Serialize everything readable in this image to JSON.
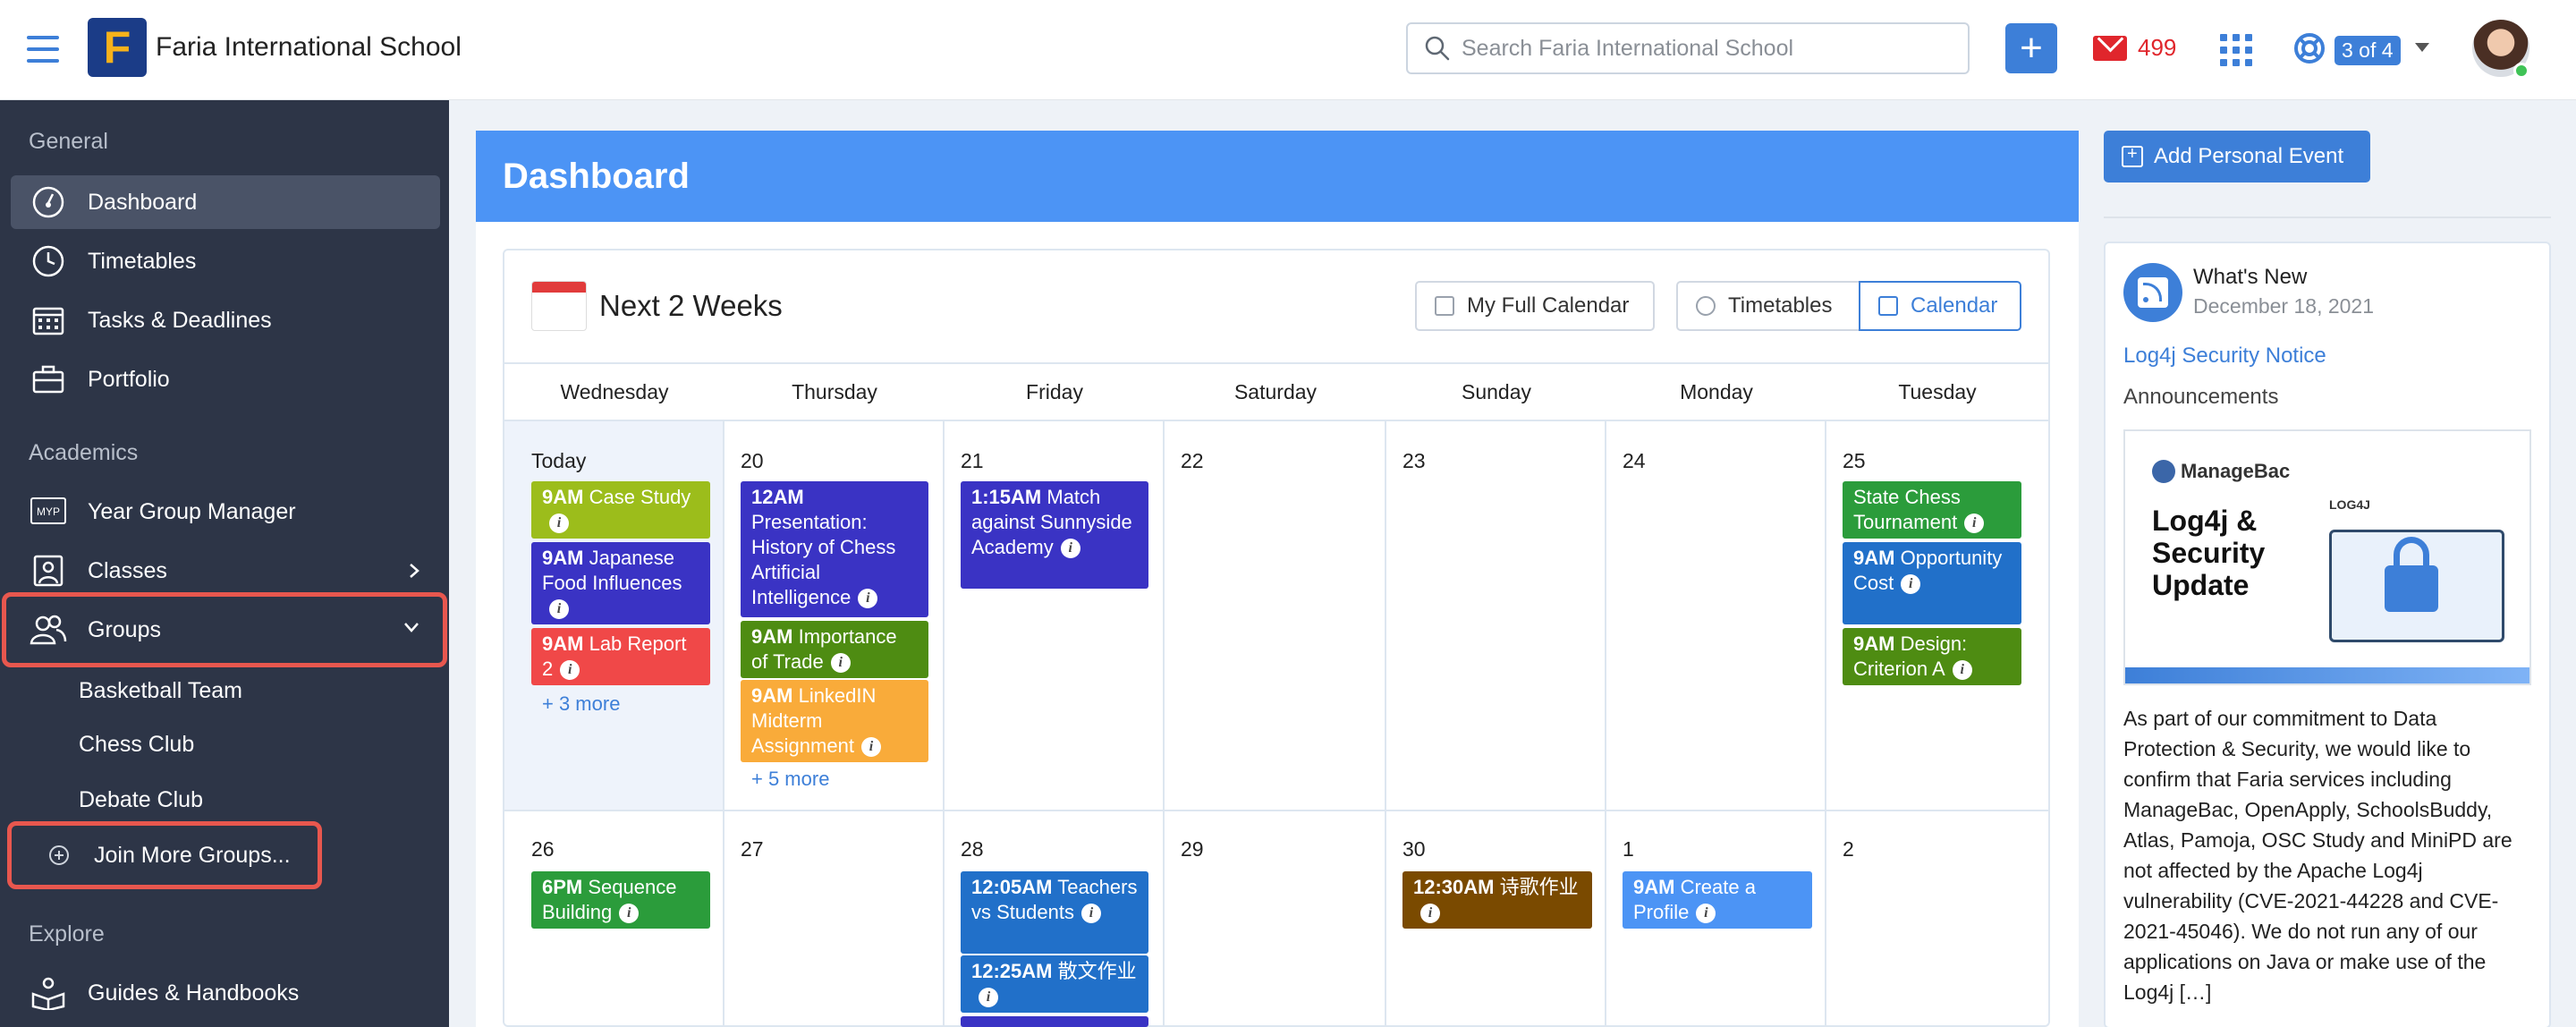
{
  "header": {
    "school_name": "Faria International School",
    "logo_letter": "F",
    "search_placeholder": "Search Faria International School",
    "add_label": "+",
    "mail_count": "499",
    "pager": "3 of 4",
    "colors": {
      "accent": "#3d7fd8",
      "mail": "#e0262c",
      "logo_bg": "#1b3c87",
      "logo_fg": "#f7b21b"
    }
  },
  "sidebar": {
    "sections": {
      "general": "General",
      "academics": "Academics",
      "explore": "Explore"
    },
    "items": {
      "dashboard": "Dashboard",
      "timetables": "Timetables",
      "tasks": "Tasks & Deadlines",
      "portfolio": "Portfolio",
      "year_group": "Year Group Manager",
      "classes": "Classes",
      "groups": "Groups",
      "guides": "Guides & Handbooks"
    },
    "groups": [
      "Basketball Team",
      "Chess Club",
      "Debate Club"
    ],
    "join_more": "Join More Groups...",
    "myp_label": "MYP"
  },
  "main": {
    "title": "Dashboard",
    "calendar": {
      "title": "Next 2 Weeks",
      "buttons": {
        "full": "My Full Calendar",
        "timetables": "Timetables",
        "calendar": "Calendar"
      },
      "days": [
        "Wednesday",
        "Thursday",
        "Friday",
        "Saturday",
        "Sunday",
        "Monday",
        "Tuesday"
      ],
      "week1": {
        "dates": [
          "Today",
          "20",
          "21",
          "22",
          "23",
          "24",
          "25"
        ],
        "wed": [
          {
            "time": "9AM",
            "title": "Case Study"
          },
          {
            "time": "9AM",
            "title": "Japanese Food Influences"
          },
          {
            "time": "9AM",
            "title": "Lab Report 2"
          }
        ],
        "wed_more": "+ 3 more",
        "thu": [
          {
            "time": "12AM",
            "title": "Presentation: History of Chess Artificial Intelligence"
          },
          {
            "time": "9AM",
            "title": "Importance of Trade"
          },
          {
            "time": "9AM",
            "title": "LinkedIN Midterm Assignment"
          }
        ],
        "thu_more": "+ 5 more",
        "fri": [
          {
            "time": "1:15AM",
            "title": "Match against Sunnyside Academy"
          }
        ],
        "tue": [
          {
            "time": "",
            "title": "State Chess Tournament"
          },
          {
            "time": "9AM",
            "title": "Opportunity Cost"
          },
          {
            "time": "9AM",
            "title": "Design: Criterion A"
          }
        ]
      },
      "week2": {
        "dates": [
          "26",
          "27",
          "28",
          "29",
          "30",
          "1",
          "2"
        ],
        "wed": [
          {
            "time": "6PM",
            "title": "Sequence Building"
          }
        ],
        "fri": [
          {
            "time": "12:05AM",
            "title": "Teachers vs Students"
          },
          {
            "time": "12:25AM",
            "title": "散文作业"
          }
        ],
        "sun": [
          {
            "time": "12:30AM",
            "title": "诗歌作业"
          }
        ],
        "mon": [
          {
            "time": "9AM",
            "title": "Create a Profile"
          }
        ]
      }
    }
  },
  "right": {
    "add_event": "Add Personal Event",
    "whats_new": "What's New",
    "date": "December 18, 2021",
    "link": "Log4j Security Notice",
    "category": "Announcements",
    "promo": {
      "brand": "ManageBac",
      "heading": "Log4j & Security Update",
      "badge": "LOG4J"
    },
    "body": "As part of our commitment to Data Protection & Security, we would like to confirm that Faria services including ManageBac, OpenApply, SchoolsBuddy, Atlas, Pamoja, OSC Study and MiniPD are not affected by the Apache Log4j vulnerability (CVE-2021-44228 and CVE-2021-45046). We do not run any of our applications on Java or make use of the Log4j […]"
  }
}
